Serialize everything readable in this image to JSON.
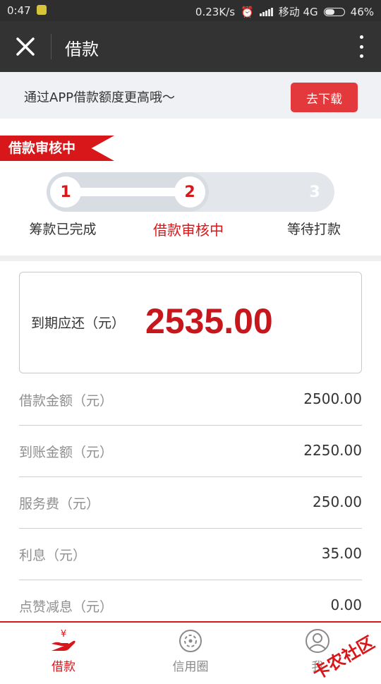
{
  "status_bar": {
    "time": "0:47",
    "network_speed": "0.23K/s",
    "carrier": "移动 4G",
    "battery": "46%",
    "battery_level": 0.46
  },
  "header": {
    "title": "借款"
  },
  "promo": {
    "text": "通过APP借款额度更高哦～",
    "button": "去下载"
  },
  "status_tag": "借款审核中",
  "steps": [
    {
      "num": "1",
      "label": "筹款已完成",
      "state": "done"
    },
    {
      "num": "2",
      "label": "借款审核中",
      "state": "active"
    },
    {
      "num": "3",
      "label": "等待打款",
      "state": "pending"
    }
  ],
  "due": {
    "label": "到期应还（元）",
    "value": "2535.00"
  },
  "details": [
    {
      "label": "借款金额（元）",
      "value": "2500.00"
    },
    {
      "label": "到账金额（元）",
      "value": "2250.00"
    },
    {
      "label": "服务费（元）",
      "value": "250.00"
    },
    {
      "label": "利息（元）",
      "value": "35.00"
    },
    {
      "label": "点赞减息（元）",
      "value": "0.00"
    }
  ],
  "tabs": [
    {
      "label": "借款",
      "icon": "loan-hand-icon",
      "active": true
    },
    {
      "label": "信用圈",
      "icon": "credit-circle-icon",
      "active": false
    },
    {
      "label": "我",
      "icon": "user-icon",
      "active": false
    }
  ],
  "watermark": "卡农社区",
  "colors": {
    "accent": "#d8171b",
    "header_bg": "#333333",
    "promo_bg": "#f0f1f4"
  }
}
